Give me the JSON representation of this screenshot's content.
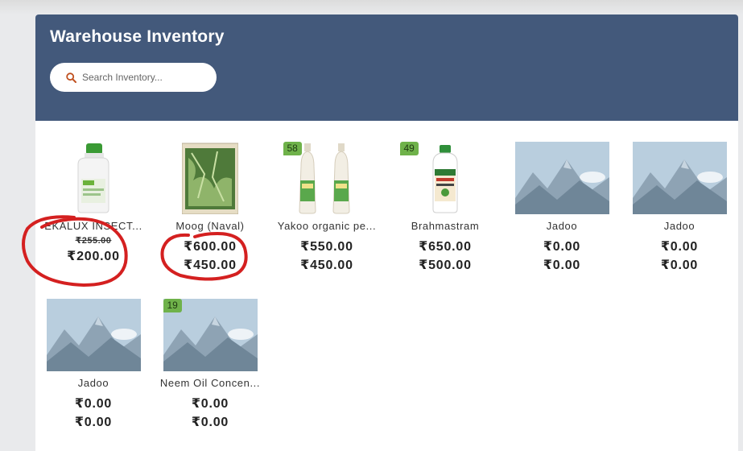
{
  "header": {
    "title": "Warehouse Inventory",
    "search_placeholder": "Search Inventory..."
  },
  "products": [
    {
      "name": "EKALUX INSECT...",
      "badge": "",
      "strike_price": "₹255.00",
      "price_1": "₹200.00",
      "price_2": "",
      "image": "bottle-white-green-cap"
    },
    {
      "name": "Moog (Naval)",
      "badge": "",
      "strike_price": "",
      "price_1": "₹600.00",
      "price_2": "₹450.00",
      "image": "seed-packet"
    },
    {
      "name": "Yakoo organic pe...",
      "badge": "58",
      "strike_price": "",
      "price_1": "₹550.00",
      "price_2": "₹450.00",
      "image": "two-bottles"
    },
    {
      "name": "Brahmastram",
      "badge": "49",
      "strike_price": "",
      "price_1": "₹650.00",
      "price_2": "₹500.00",
      "image": "bottle-green-cap"
    },
    {
      "name": "Jadoo",
      "badge": "",
      "strike_price": "",
      "price_1": "₹0.00",
      "price_2": "₹0.00",
      "image": "placeholder-mountains"
    },
    {
      "name": "Jadoo",
      "badge": "",
      "strike_price": "",
      "price_1": "₹0.00",
      "price_2": "₹0.00",
      "image": "placeholder-mountains"
    },
    {
      "name": "Jadoo",
      "badge": "",
      "strike_price": "",
      "price_1": "₹0.00",
      "price_2": "₹0.00",
      "image": "placeholder-mountains"
    },
    {
      "name": "Neem Oil Concen...",
      "badge": "19",
      "strike_price": "",
      "price_1": "₹0.00",
      "price_2": "₹0.00",
      "image": "placeholder-mountains"
    }
  ],
  "colors": {
    "header_bg": "#43597b",
    "badge_bg": "#6fb24a",
    "annotation_red": "#d42020"
  }
}
